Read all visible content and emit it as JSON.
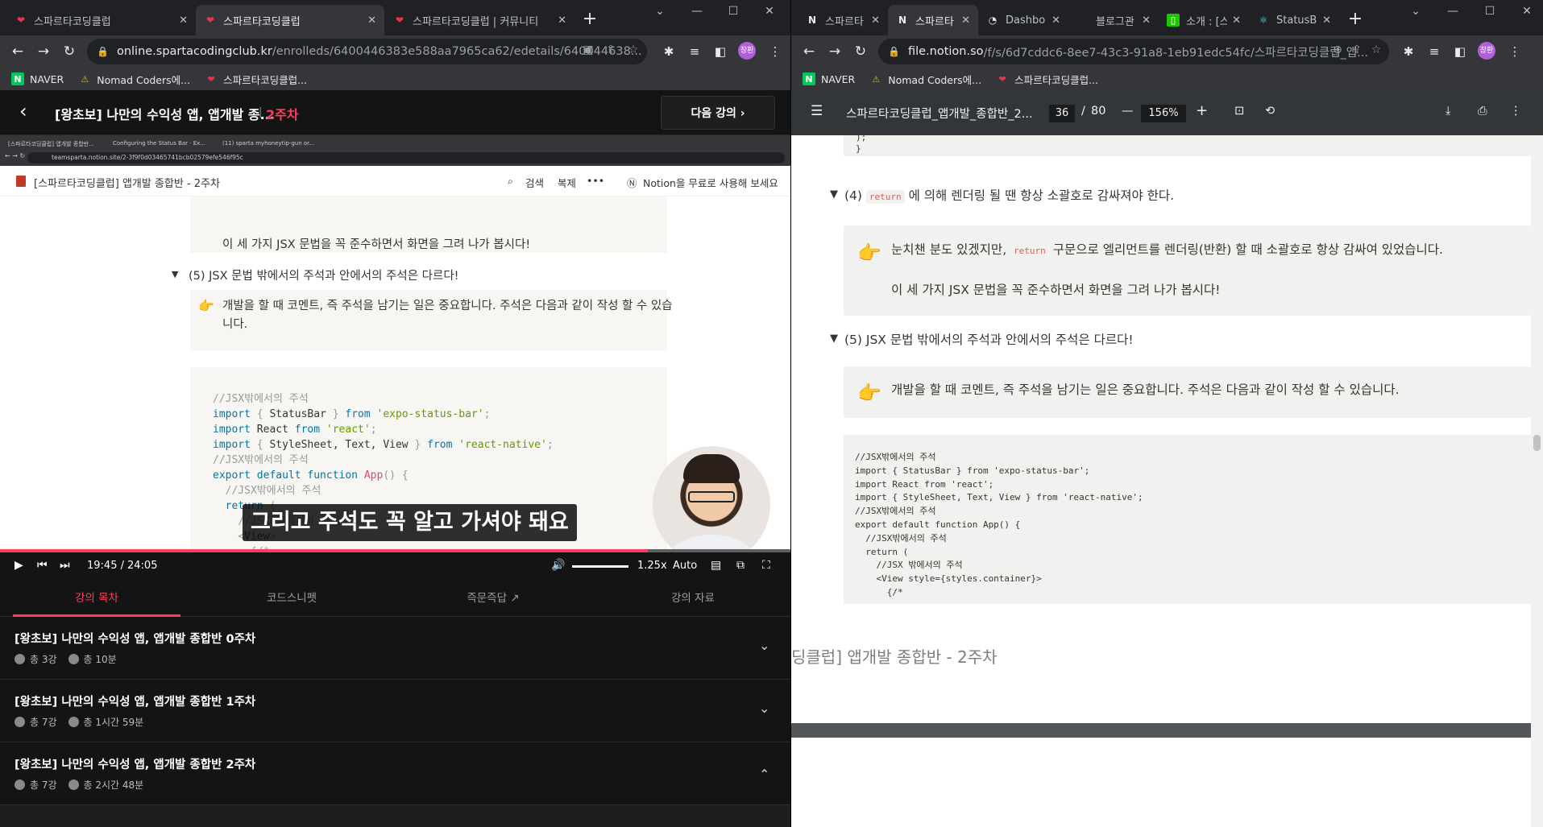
{
  "left_browser": {
    "tabs": [
      {
        "title": "스파르타코딩클럽",
        "close": "✕"
      },
      {
        "title": "스파르타코딩클럽",
        "close": "✕"
      },
      {
        "title": "스파르타코딩클럽 | 커뮤니티",
        "close": "✕"
      }
    ],
    "url_host": "online.spartacodingclub.kr",
    "url_path": "/enrolleds/6400446383e588aa7965ca62/edetails/640044638...",
    "bookmarks": [
      "NAVER",
      "Nomad Coders에...",
      "스파르타코딩클럽..."
    ],
    "profile_initial": "창환"
  },
  "lecture": {
    "back_icon": "‹",
    "title": "[왕초보] 나만의 수익성 앱, 앱개발 종...",
    "separator": "|",
    "week": "2주차",
    "next_label": "다음 강의  ›"
  },
  "video": {
    "inner_tabs": [
      "[스파르타코딩클럽] 앱개발 종합반...",
      "Configuring the Status Bar · Ex...",
      "(11) sparta myhoneytip-gun or..."
    ],
    "inner_url": "teamsparta.notion.site/2-3f9f0d03465741bcb02579efe546f95c",
    "notion_title": "[스파르타코딩클럽] 앱개발 종합반 - 2주차",
    "notion_search": "검색",
    "notion_duplicate": "복제",
    "notion_more": "•••",
    "notion_cta": "Notion을 무료로 사용해 보세요",
    "doc_line1": "이 세 가지 JSX 문법을 꼭 준수하면서 화면을 그려 나가 봅시다!",
    "doc_toggle": "(5) JSX 문법 밖에서의 주석과 안에서의 주석은 다르다!",
    "doc_callout_1": "개발을 할 때 코멘트, 즉 주석을 남기는 일은 중요합니다. 주석은 다음과 같이 작성 할 수 있습",
    "doc_callout_2": "니다.",
    "subtitle": "그리고 주석도 꼭 알고 가셔야 돼요",
    "time_current": "19:45 /",
    "time_total": "24:05",
    "speed": "1.25x",
    "quality": "Auto",
    "progress_ratio": 0.82
  },
  "course_tabs": [
    "강의 목차",
    "코드스니펫",
    "즉문즉답 ↗",
    "강의 자료"
  ],
  "chapters": [
    {
      "title": "[왕초보] 나만의 수익성 앱, 앱개발 종합반 0주차",
      "lessons": "총 3강",
      "duration": "총 10분",
      "chev": "⌄"
    },
    {
      "title": "[왕초보] 나만의 수익성 앱, 앱개발 종합반 1주차",
      "lessons": "총 7강",
      "duration": "총 1시간 59분",
      "chev": "⌄"
    },
    {
      "title": "[왕초보] 나만의 수익성 앱, 앱개발 종합반 2주차",
      "lessons": "총 7강",
      "duration": "총 2시간 48분",
      "chev": "⌃"
    }
  ],
  "right_browser": {
    "tabs": [
      {
        "title": "스파르타",
        "close": "✕"
      },
      {
        "title": "스파르타",
        "close": "✕"
      },
      {
        "title": "Dashbo",
        "close": "✕"
      },
      {
        "title": "블로그관",
        "close": "✕"
      },
      {
        "title": "소개 : [스",
        "close": "✕"
      },
      {
        "title": "StatusBa",
        "close": "✕"
      }
    ],
    "url_host": "file.notion.so",
    "url_path": "/f/s/6d7cddc6-8ee7-43c3-91a8-1eb91edc54fc/스파르타코딩클럽_앱...",
    "bookmarks": [
      "NAVER",
      "Nomad Coders에...",
      "스파르타코딩클럽..."
    ],
    "profile_initial": "창환"
  },
  "pdf": {
    "menu_icon": "☰",
    "filename": "스파르타코딩클럽_앱개발_종합반_2...",
    "page_current": "36",
    "page_sep": "/",
    "page_total": "80",
    "zoom": "156%",
    "code_top_1": "  );",
    "code_top_2": "}",
    "toggle4_prefix": "(4) ",
    "toggle4_code": "return",
    "toggle4_suffix": " 에 의해 렌더링 될 땐 항상 소괄호로 감싸져야 한다.",
    "callout4_prefix": "눈치챈 분도 있겠지만, ",
    "callout4_code": "return",
    "callout4_suffix": " 구문으로 엘리먼트를 렌더링(반환) 할 때 소괄호로 항상 감싸여 있었습니다.",
    "callout4_line2": "이 세 가지 JSX 문법을 꼭 준수하면서 화면을 그려 나가 봅시다!",
    "toggle5": "(5) JSX 문법 밖에서의 주석과 안에서의 주석은 다르다!",
    "callout5": "개발을 할 때 코멘트, 즉 주석을 남기는 일은 중요합니다. 주석은 다음과 같이 작성 할 수 있습니다.",
    "code_lines": [
      "//JSX밖에서의 주석",
      "import { StatusBar } from 'expo-status-bar';",
      "import React from 'react';",
      "import { StyleSheet, Text, View } from 'react-native';",
      "//JSX밖에서의 주석",
      "export default function App() {",
      "  //JSX밖에서의 주석",
      "  return (",
      "    //JSX 밖에서의 주석",
      "    <View style={styles.container}>",
      "      {/*"
    ],
    "footer": "딩클럽] 앱개발 종합반 - 2주차"
  }
}
